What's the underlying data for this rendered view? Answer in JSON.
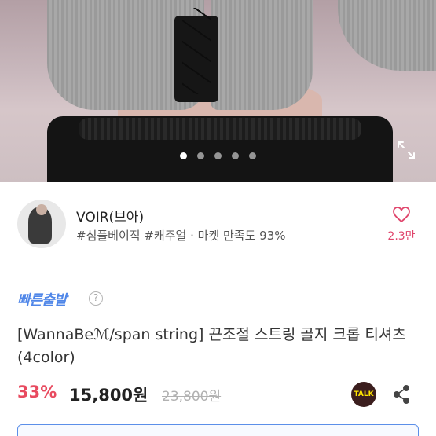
{
  "gallery": {
    "dot_count": 5,
    "active_dot": 0
  },
  "seller": {
    "name": "VOIR(브아)",
    "meta": "#심플베이직 #캐주얼 · 마켓 만족도 93%",
    "likes": "2.3만"
  },
  "product": {
    "fast_delivery": "빠른출발",
    "help": "?",
    "title": "[WannaBeℳ/span string] 끈조절 스트링 골지 크롭 티셔츠 (4color)",
    "discount": "33%",
    "price": "15,800원",
    "original_price": "23,800원",
    "talk_label": "TALK"
  },
  "colors": {
    "accent_blue": "#4f86e8",
    "discount_red": "#e84a5f",
    "heart_pink": "#e0456c"
  },
  "icons": [
    "expand-icon",
    "heart-icon",
    "help-icon",
    "talk-icon",
    "share-icon"
  ]
}
